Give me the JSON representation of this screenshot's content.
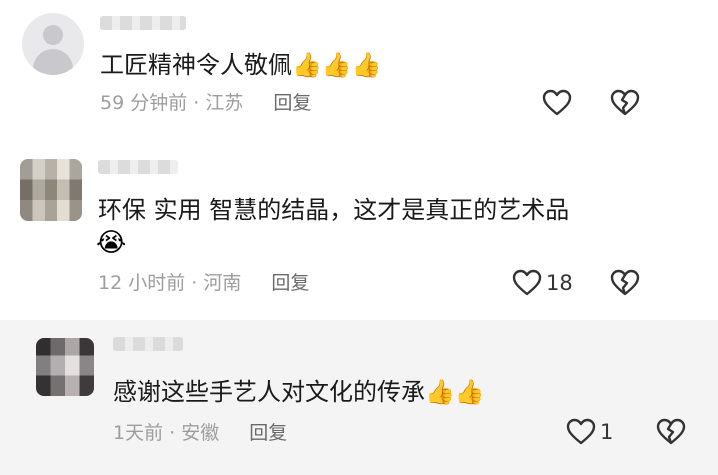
{
  "comments": [
    {
      "text": "工匠精神令人敬佩👍👍👍",
      "time_location": "59 分钟前 · 江苏",
      "reply_label": "回复",
      "likes": ""
    },
    {
      "text": "环保   实用  智慧的结晶，这才是真正的艺术品",
      "emoji": "😭",
      "time_location": "12 小时前 · 河南",
      "reply_label": "回复",
      "likes": "18"
    },
    {
      "text": "感谢这些手艺人对文化的传承👍👍",
      "time_location": "1天前 · 安徽",
      "reply_label": "回复",
      "likes": "1"
    }
  ],
  "icons": {
    "like": "heart-outline-icon",
    "dislike": "broken-heart-icon",
    "avatar_default": "default-avatar-icon"
  },
  "colors": {
    "text": "#1a1a1a",
    "meta": "#9d9d9d",
    "reply": "#6a6a6a",
    "highlight_bg": "#f4f4f4"
  }
}
